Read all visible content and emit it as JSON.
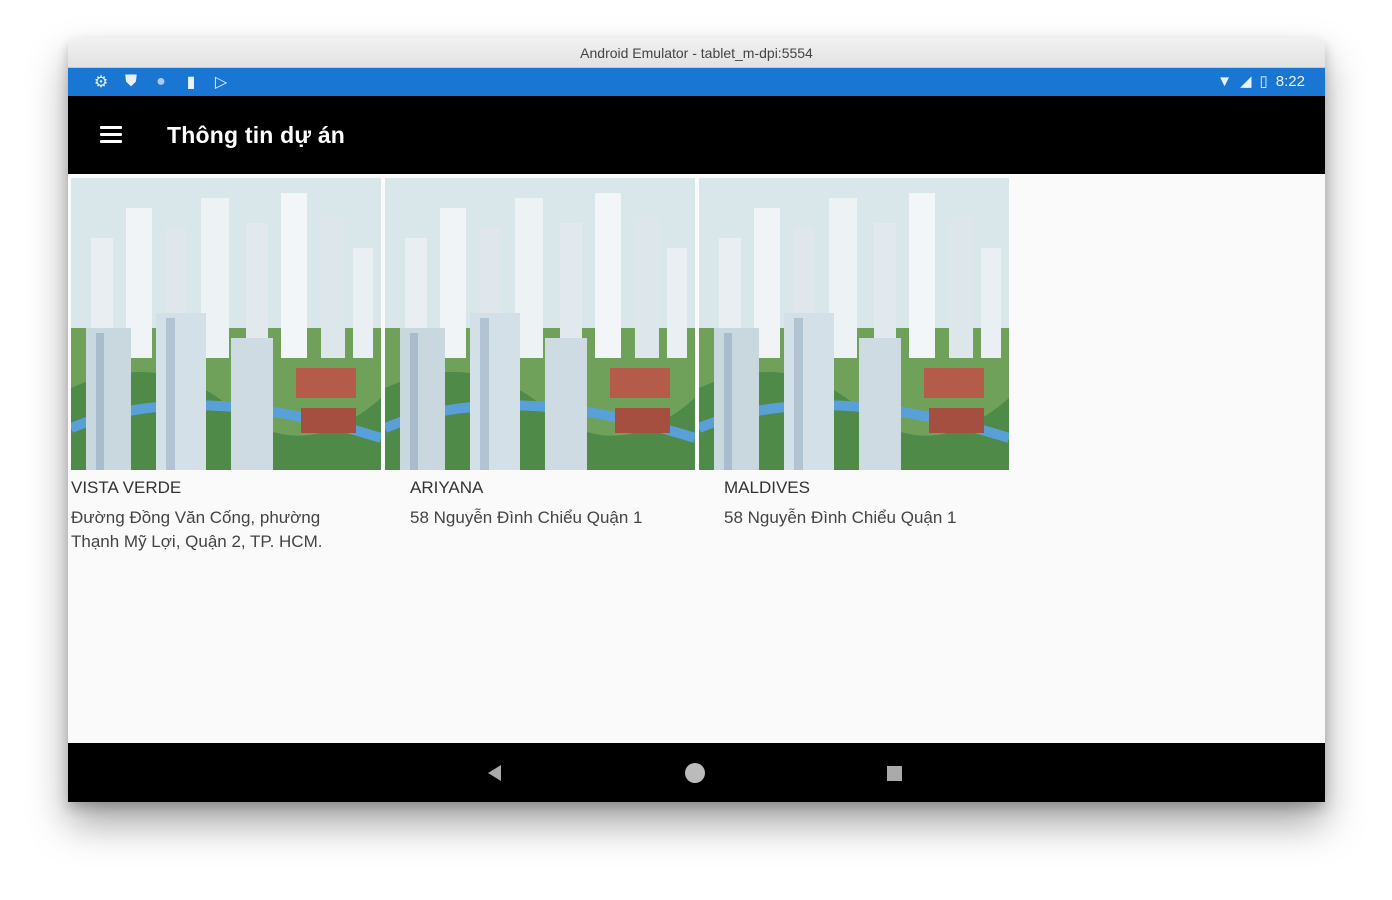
{
  "window": {
    "title": "Android Emulator - tablet_m-dpi:5554"
  },
  "status_bar": {
    "left_icons": [
      "settings-icon",
      "shield-icon",
      "circle-icon",
      "sd-card-icon",
      "play-store-icon"
    ],
    "right_icons": [
      "wifi-icon",
      "signal-icon",
      "battery-icon"
    ],
    "time": "8:22",
    "color": "#1976d2"
  },
  "toolbar": {
    "title": "Thông tin dự án",
    "menu_icon": "hamburger-menu-icon",
    "color": "#000000"
  },
  "projects": [
    {
      "name": "VISTA VERDE",
      "address": "Đường Đồng Văn Cống, phường Thạnh Mỹ Lợi, Quận 2, TP. HCM."
    },
    {
      "name": "ARIYANA",
      "address": "58 Nguyễn Đình Chiểu Quận 1"
    },
    {
      "name": "MALDIVES",
      "address": "58 Nguyễn Đình Chiểu Quận 1"
    }
  ],
  "nav_bar": {
    "icons": [
      "back-icon",
      "home-icon",
      "recent-apps-icon"
    ]
  }
}
